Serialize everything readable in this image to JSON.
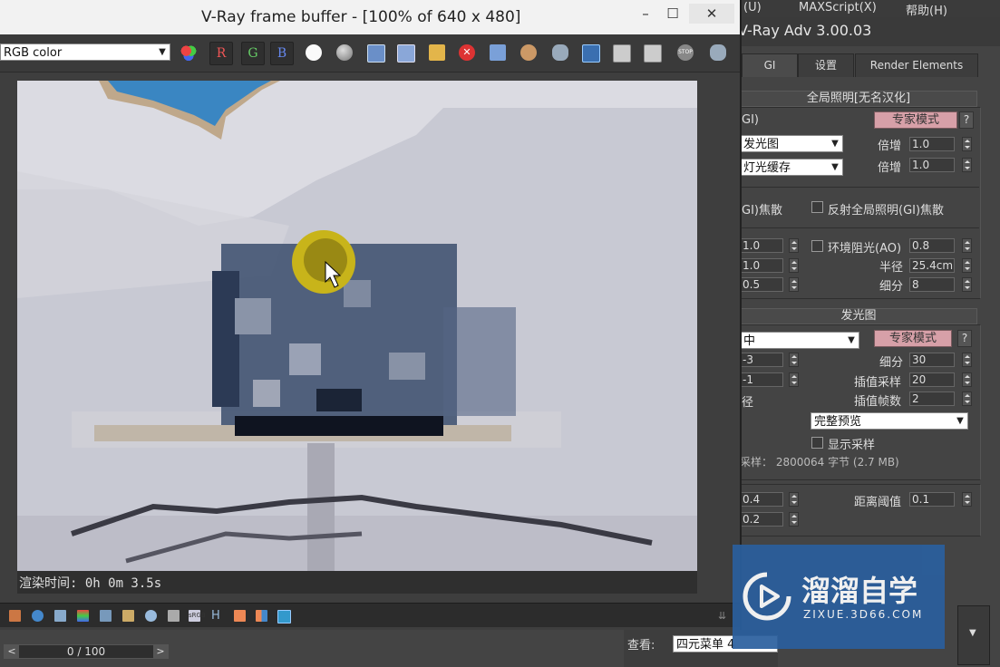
{
  "vfb": {
    "title": "V-Ray frame buffer - [100% of 640 x 480]",
    "channel_select": "RGB color",
    "rgb_buttons": [
      "R",
      "G",
      "B"
    ],
    "toolbar_icons": [
      "color-wheel-icon",
      "white-circle-icon",
      "gray-circle-icon",
      "save-icon",
      "copy-icon",
      "folder-icon",
      "stop-render-icon",
      "track-mouse-icon",
      "region-render-icon",
      "teapot-icon",
      "lens-icon",
      "history-icon",
      "compare-icon",
      "stop-icon",
      "teapot-render-icon"
    ],
    "status_text": "渲染时间: 0h 0m 3.5s",
    "bottom_icons": [
      "layers-icon",
      "info-icon",
      "stats-icon",
      "color-bars-icon",
      "levels-icon",
      "curve-icon",
      "hsv-icon",
      "gamma-icon",
      "srgb-icon",
      "h-icon",
      "lens-effects-icon",
      "lut-icon",
      "ocio-icon"
    ]
  },
  "menu": {
    "items": [
      "(U)",
      "MAXScript(X)",
      "帮助(H)"
    ]
  },
  "renderer": {
    "title": "V-Ray Adv 3.00.03",
    "tabs": [
      "GI",
      "设置",
      "Render Elements"
    ],
    "gi_rollout": {
      "header": "全局照明[无名汉化]",
      "gi_label": "GI)",
      "expert_label": "专家模式",
      "help_label": "?",
      "primary_engine": "发光图",
      "secondary_engine": "灯光缓存",
      "multiplier_label": "倍增",
      "primary_multiplier": "1.0",
      "secondary_multiplier": "1.0",
      "refractive_caustics": "GI)焦散",
      "reflective_caustics": "反射全局照明(GI)焦散",
      "saturation": "1.0",
      "contrast": "1.0",
      "contrast_base": "0.5",
      "ao_label": "环境阻光(AO)",
      "ao_value": "0.8",
      "radius_label": "半径",
      "radius_value": "25.4cm",
      "subdivs_label": "细分",
      "ao_subdivs": "8"
    },
    "irradiance_rollout": {
      "header": "发光图",
      "preset": "中",
      "expert_label": "专家模式",
      "help_label": "?",
      "min_rate": "-3",
      "max_rate": "-1",
      "subdivs_label": "细分",
      "subdivs": "30",
      "interp_label": "插值采样",
      "interp_samples": "20",
      "frames_label": "插值帧数",
      "interp_frames": "2",
      "radius_label": "径",
      "mode": "完整预览",
      "show_samples": "显示采样",
      "samples_info": "采样：  2800064 字节 (2.7 MB)",
      "color_thresh": "0.4",
      "normal_thresh": "0.2",
      "dist_label": "距离阈值",
      "dist_value": "0.1"
    }
  },
  "timeline": {
    "frame": "0 / 100",
    "left": "<",
    "right": ">"
  },
  "viewbar": {
    "label": "查看:",
    "value": "四元菜单 4"
  },
  "watermark": {
    "brand": "溜溜自学",
    "site": "ZIXUE.3D66.COM"
  }
}
